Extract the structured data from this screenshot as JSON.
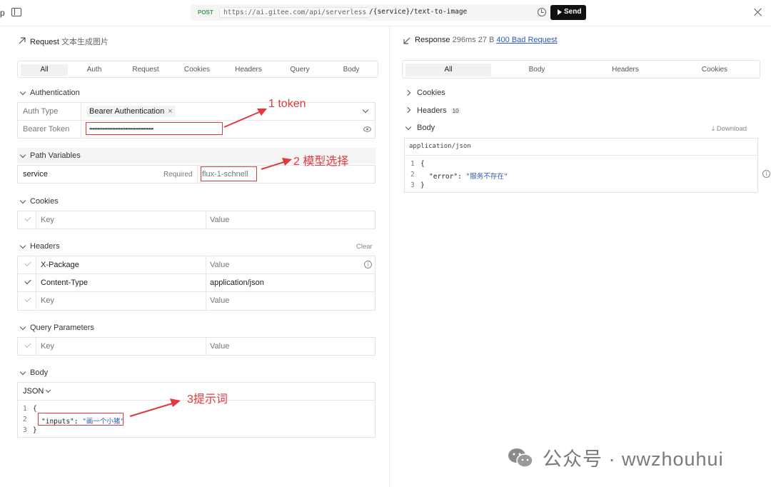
{
  "topbar": {
    "edge_char": "p",
    "method": "POST",
    "url_base": "https://ai.gitee.com/api/serverless",
    "url_path": "/{service}/text-to-image",
    "send_label": "Send"
  },
  "request": {
    "title": "Request",
    "subtitle": "文本生成图片",
    "tabs": [
      "All",
      "Auth",
      "Request",
      "Cookies",
      "Headers",
      "Query",
      "Body"
    ],
    "active_tab": "All",
    "authentication": {
      "heading": "Authentication",
      "auth_type_label": "Auth Type",
      "auth_type_value": "Bearer Authentication",
      "bearer_label": "Bearer Token",
      "bearer_value": "•••••••••••••••••••••••••••••••••••••••"
    },
    "path_variables": {
      "heading": "Path Variables",
      "name": "service",
      "required": "Required",
      "value": "flux-1-schnell"
    },
    "cookies": {
      "heading": "Cookies",
      "key_placeholder": "Key",
      "value_placeholder": "Value"
    },
    "headers": {
      "heading": "Headers",
      "clear_label": "Clear",
      "rows": [
        {
          "key": "X-Package",
          "value": "Value",
          "checked": false,
          "value_muted": true
        },
        {
          "key": "Content-Type",
          "value": "application/json",
          "checked": true,
          "value_muted": false
        },
        {
          "key": "Key",
          "value": "Value",
          "checked": false,
          "value_muted": true
        }
      ]
    },
    "query": {
      "heading": "Query Parameters",
      "key_placeholder": "Key",
      "value_placeholder": "Value"
    },
    "body": {
      "heading": "Body",
      "format": "JSON",
      "lines": [
        "{",
        "\"inputs\": \"画一个小猪\"",
        "}"
      ],
      "line_numbers": [
        "1",
        "2",
        "3"
      ]
    }
  },
  "response": {
    "title": "Response",
    "time": "296ms",
    "size": "27 B",
    "status": "400 Bad Request",
    "tabs": [
      "All",
      "Body",
      "Headers",
      "Cookies"
    ],
    "active_tab": "All",
    "cookies_label": "Cookies",
    "headers_label": "Headers",
    "headers_count": "10",
    "body_label": "Body",
    "download_label": "Download",
    "content_type": "application/json",
    "lines": [
      "{",
      "\"error\": \"服务不存在\"",
      "}"
    ],
    "line_numbers": [
      "1",
      "2",
      "3"
    ]
  },
  "annotations": {
    "a1": "1 token",
    "a2": "2  模型选择",
    "a3": "3提示词"
  },
  "watermark": "公众号 · wwzhouhui",
  "colors": {
    "annotation": "#e0393e",
    "link": "#2b5bb8",
    "send_bg": "#111111"
  }
}
